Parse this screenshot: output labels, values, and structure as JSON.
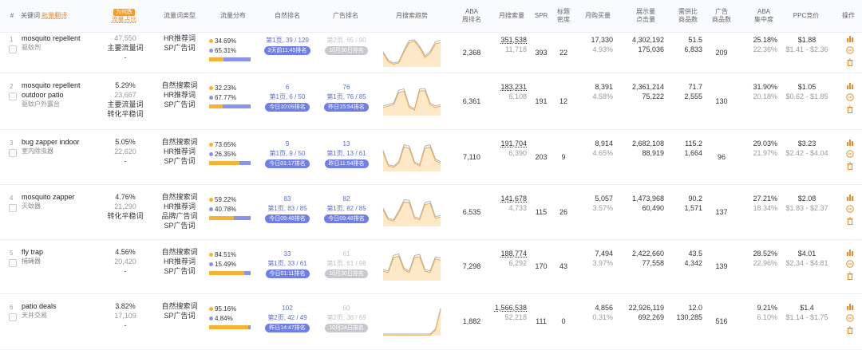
{
  "header": {
    "num": "#",
    "keyword": "关键词",
    "translate": "批量翻译",
    "traffic_tag": "为何跌",
    "traffic_share": "流量占比",
    "traffic_type": "流量词类型",
    "traffic_dist": "流量分布",
    "organic_rank": "自然排名",
    "ad_rank": "广告排名",
    "trend": "月搜索趋势",
    "aba_rank": "ABA\n周排名",
    "monthly_search": "月搜索量",
    "spr": "SPR",
    "title_density": "标题\n密度",
    "monthly_purchase": "月购买量",
    "impressions_clicks": "展示量\n点击量",
    "demand_supply": "需供比\n商品数",
    "ad_products": "广告\n商品数",
    "aba_concentration": "ABA\n集中度",
    "ppc": "PPC竞价",
    "actions": "操作"
  },
  "rows": [
    {
      "idx": "1",
      "kw": "mosquito repellent",
      "kw_cn": "驱蚊剂",
      "share": "",
      "share_sub": "47,550",
      "traffic_note1": "主要流量词",
      "traffic_note2": "-",
      "types": [
        "HR推荐词",
        "SP广告词"
      ],
      "nat_pct": "34.69%",
      "ad_pct": "65.31%",
      "nat": 34.69,
      "org_rank": "",
      "org_page": "第1页, 39 / 129",
      "org_pill": "3天前11:45排名",
      "ad_rank": "",
      "ad_page": "第2页, 65 / 90",
      "ad_pill": "10月30日排名",
      "ad_dim": true,
      "trend": [
        0.5,
        0.2,
        0.1,
        0.15,
        0.55,
        0.9,
        0.95,
        0.7,
        0.35,
        0.5,
        0.85,
        0.9
      ],
      "aba": "2,368",
      "ms": "351,538",
      "ms2": "11,718",
      "spr": "393",
      "td": "22",
      "mp": "17,330",
      "mp2": "4.93%",
      "imp": "4,302,192",
      "clk": "175,036",
      "ds": "51.5",
      "pc": "6,833",
      "adp": "209",
      "abac": "25.18%",
      "abac2": "22.36%",
      "ppc": "$1.88",
      "ppc2": "$1.41 - $2.36"
    },
    {
      "idx": "2",
      "kw": "mosquito repellent outdoor patio",
      "kw_cn": "驱蚊户外露台",
      "share": "5.29%",
      "share_sub": "23,667",
      "traffic_note1": "主要流量词",
      "traffic_note2": "转化平稳词",
      "types": [
        "自然搜索词",
        "HR推荐词",
        "SP广告词"
      ],
      "nat_pct": "32.23%",
      "ad_pct": "67.77%",
      "nat": 32.23,
      "org_rank": "6",
      "org_page": "第1页, 6 / 50",
      "org_pill": "今日10:09排名",
      "ad_rank": "76",
      "ad_page": "第1页, 76 / 85",
      "ad_pill": "昨日15:54排名",
      "ad_dim": false,
      "trend": [
        0.3,
        0.35,
        0.4,
        0.85,
        0.9,
        0.3,
        0.2,
        0.9,
        0.92,
        0.4,
        0.3,
        0.35
      ],
      "aba": "6,361",
      "ms": "183,231",
      "ms2": "6,108",
      "spr": "191",
      "td": "12",
      "mp": "8,391",
      "mp2": "4.58%",
      "imp": "2,361,214",
      "clk": "75,222",
      "ds": "71.7",
      "pc": "2,555",
      "adp": "130",
      "abac": "31.90%",
      "abac2": "20.18%",
      "ppc": "$1.05",
      "ppc2": "$0.62 - $1.85"
    },
    {
      "idx": "3",
      "kw": "bug zapper indoor",
      "kw_cn": "室内除虫器",
      "share": "5.05%",
      "share_sub": "22,620",
      "traffic_note1": "-",
      "traffic_note2": "",
      "types": [
        "自然搜索词",
        "HR推荐词",
        "SP广告词"
      ],
      "nat_pct": "73.65%",
      "ad_pct": "26.35%",
      "nat": 73.65,
      "org_rank": "9",
      "org_page": "第1页, 9 / 50",
      "org_pill": "今日01:17排名",
      "ad_rank": "13",
      "ad_page": "第1页, 13 / 61",
      "ad_pill": "昨日11:54排名",
      "ad_dim": false,
      "trend": [
        0.7,
        0.2,
        0.15,
        0.3,
        0.9,
        0.85,
        0.3,
        0.2,
        0.85,
        0.9,
        0.4,
        0.3
      ],
      "aba": "7,110",
      "ms": "191,704",
      "ms2": "6,390",
      "spr": "203",
      "td": "9",
      "mp": "8,914",
      "mp2": "4.65%",
      "imp": "2,682,108",
      "clk": "88,919",
      "ds": "115.2",
      "pc": "1,664",
      "adp": "96",
      "abac": "29.03%",
      "abac2": "21.97%",
      "ppc": "$3.23",
      "ppc2": "$2.42 - $4.04"
    },
    {
      "idx": "4",
      "kw": "mosquito zapper",
      "kw_cn": "灭蚊器",
      "share": "4.76%",
      "share_sub": "21,290",
      "traffic_note1": "转化平稳词",
      "traffic_note2": "",
      "types": [
        "自然搜索词",
        "HR推荐词",
        "品牌广告词",
        "SP广告词"
      ],
      "nat_pct": "59.22%",
      "ad_pct": "40.78%",
      "nat": 59.22,
      "org_rank": "83",
      "org_page": "第1页, 83 / 85",
      "org_pill": "今日09:48排名",
      "ad_rank": "82",
      "ad_page": "第1页, 82 / 85",
      "ad_pill": "今日09:48排名",
      "ad_dim": false,
      "trend": [
        0.6,
        0.25,
        0.2,
        0.5,
        0.9,
        0.88,
        0.3,
        0.25,
        0.8,
        0.85,
        0.3,
        0.35
      ],
      "aba": "6,535",
      "ms": "141,678",
      "ms2": "4,733",
      "spr": "115",
      "td": "26",
      "mp": "5,057",
      "mp2": "3.57%",
      "imp": "1,473,968",
      "clk": "60,490",
      "ds": "90.2",
      "pc": "1,571",
      "adp": "137",
      "abac": "27.21%",
      "abac2": "18.34%",
      "ppc": "$2.08",
      "ppc2": "$1.83 - $2.37"
    },
    {
      "idx": "5",
      "kw": "fly trap",
      "kw_cn": "捕蝇器",
      "share": "4.56%",
      "share_sub": "20,420",
      "traffic_note1": "-",
      "traffic_note2": "",
      "types": [
        "自然搜索词",
        "HR推荐词",
        "SP广告词"
      ],
      "nat_pct": "84.51%",
      "ad_pct": "15.49%",
      "nat": 84.51,
      "org_rank": "33",
      "org_page": "第1页, 33 / 61",
      "org_pill": "今日01:11排名",
      "ad_rank": "61",
      "ad_page": "第1页, 61 / 98",
      "ad_pill": "10月30日排名",
      "ad_dim": true,
      "trend": [
        0.35,
        0.3,
        0.85,
        0.9,
        0.4,
        0.3,
        0.85,
        0.88,
        0.35,
        0.3,
        0.8,
        0.75
      ],
      "aba": "7,298",
      "ms": "188,774",
      "ms2": "6,292",
      "spr": "170",
      "td": "43",
      "mp": "7,494",
      "mp2": "3.97%",
      "imp": "2,422,660",
      "clk": "77,558",
      "ds": "43.5",
      "pc": "4,342",
      "adp": "139",
      "abac": "28.52%",
      "abac2": "22.96%",
      "ppc": "$4.01",
      "ppc2": "$2.34 - $4.81"
    },
    {
      "idx": "6",
      "kw": "patio deals",
      "kw_cn": "天井交易",
      "share": "3.82%",
      "share_sub": "17,109",
      "traffic_note1": "-",
      "traffic_note2": "",
      "types": [
        "自然搜索词",
        "SP广告词"
      ],
      "nat_pct": "95.16%",
      "ad_pct": "4.84%",
      "nat": 95.16,
      "org_rank": "102",
      "org_page": "第2页, 42 / 49",
      "org_pill": "昨日14:47排名",
      "ad_rank": "60",
      "ad_page": "第2页, 36 / 69",
      "ad_pill": "10月24日排名",
      "ad_dim": true,
      "trend": [
        0.02,
        0.02,
        0.02,
        0.02,
        0.02,
        0.02,
        0.02,
        0.02,
        0.02,
        0.02,
        0.2,
        0.95
      ],
      "aba": "1,882",
      "ms": "1,566,538",
      "ms2": "52,218",
      "spr": "111",
      "td": "0",
      "mp": "4,856",
      "mp2": "0.31%",
      "imp": "22,926,119",
      "clk": "692,269",
      "ds": "12.0",
      "pc": "130,285",
      "adp": "516",
      "abac": "9.21%",
      "abac2": "6.10%",
      "ppc": "$1.4",
      "ppc2": "$1.14 - $1.75"
    }
  ],
  "icons": {
    "chart": "bar-chart-icon",
    "minus": "minus-circle-icon",
    "trash": "trash-icon"
  },
  "colors": {
    "natural": "#f5b335",
    "ad": "#8a93e8",
    "pill_blue": "#6f7fe6",
    "pill_gray": "#c7c9cf",
    "accent": "#f08a24"
  }
}
